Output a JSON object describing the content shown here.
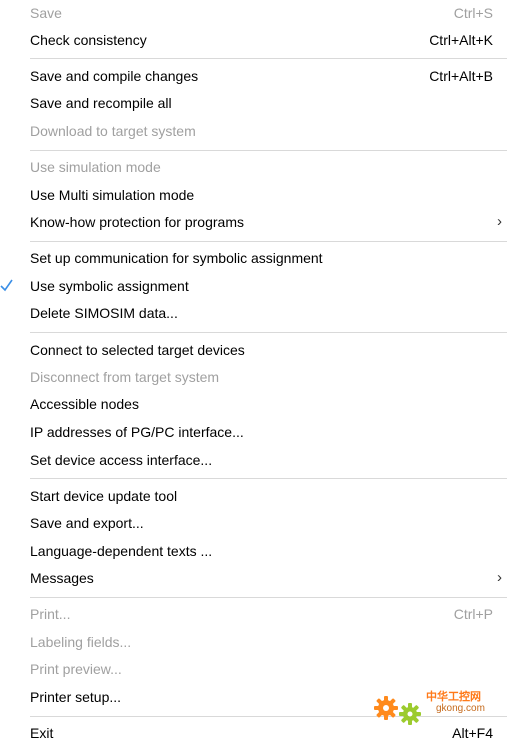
{
  "menu": {
    "save": {
      "label": "Save",
      "shortcut": "Ctrl+S"
    },
    "check_consistency": {
      "label": "Check consistency",
      "shortcut": "Ctrl+Alt+K"
    },
    "save_compile": {
      "label": "Save and compile changes",
      "shortcut": "Ctrl+Alt+B"
    },
    "save_recompile": {
      "label": "Save and recompile all"
    },
    "download": {
      "label": "Download to target system"
    },
    "use_sim": {
      "label": "Use simulation mode"
    },
    "use_multi_sim": {
      "label": "Use Multi simulation mode"
    },
    "knowhow": {
      "label": "Know-how protection for programs",
      "arrow": "›"
    },
    "setup_comm": {
      "label": "Set up communication for symbolic assignment"
    },
    "use_symbolic": {
      "label": "Use symbolic assignment",
      "checked": true
    },
    "delete_simosim": {
      "label": "Delete SIMOSIM data..."
    },
    "connect": {
      "label": "Connect to selected target devices"
    },
    "disconnect": {
      "label": "Disconnect from target system"
    },
    "accessible_nodes": {
      "label": "Accessible nodes"
    },
    "ip_addresses": {
      "label": "IP addresses of PG/PC interface..."
    },
    "set_device_access": {
      "label": "Set device access interface..."
    },
    "start_update": {
      "label": "Start device update tool"
    },
    "save_export": {
      "label": "Save and export..."
    },
    "language_texts": {
      "label": "Language-dependent texts ..."
    },
    "messages": {
      "label": "Messages",
      "arrow": "›"
    },
    "print": {
      "label": "Print...",
      "shortcut": "Ctrl+P"
    },
    "labeling_fields": {
      "label": "Labeling fields..."
    },
    "print_preview": {
      "label": "Print preview..."
    },
    "printer_setup": {
      "label": "Printer setup..."
    },
    "exit": {
      "label": "Exit",
      "shortcut": "Alt+F4"
    }
  },
  "watermark": {
    "cn": "中华工控网",
    "en": "gkong.com"
  },
  "colors": {
    "disabled_text": "#a0a0a0",
    "separator": "#d9d9d9",
    "check": "#3a8ee6",
    "logo_orange": "#ff7a1a"
  },
  "icons": {
    "check": "checkmark-icon",
    "submenu": "chevron-right-icon",
    "logo": "gear-logo-icon"
  }
}
